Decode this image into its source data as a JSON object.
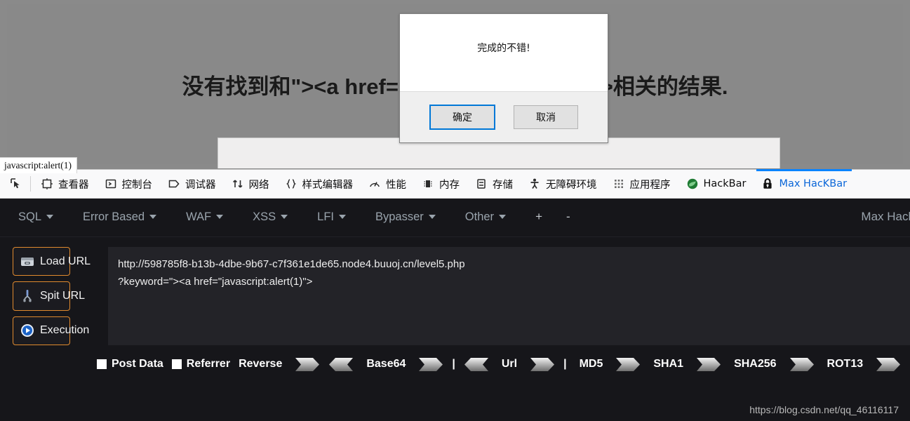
{
  "webpage": {
    "heading": "没有找到和\"><a href=\"javascript:alert(1)\">相关的结果.",
    "heading_left": "没有找到和\"><a href=\"javascript:alert",
    "heading_right": "(1)\">相关的结果."
  },
  "status_tooltip": {
    "text": "javascript:alert(1)"
  },
  "dialog": {
    "message": "完成的不错!",
    "ok_label": "确定",
    "cancel_label": "取消"
  },
  "devtools": {
    "picker_icon": "element-picker-icon",
    "tabs": [
      {
        "label": "查看器",
        "icon": "inspector-icon",
        "active": false
      },
      {
        "label": "控制台",
        "icon": "console-icon",
        "active": false
      },
      {
        "label": "调试器",
        "icon": "debugger-icon",
        "active": false
      },
      {
        "label": "网络",
        "icon": "network-icon",
        "active": false
      },
      {
        "label": "样式编辑器",
        "icon": "style-editor-icon",
        "active": false
      },
      {
        "label": "性能",
        "icon": "performance-icon",
        "active": false
      },
      {
        "label": "内存",
        "icon": "memory-icon",
        "active": false
      },
      {
        "label": "存储",
        "icon": "storage-icon",
        "active": false
      },
      {
        "label": "无障碍环境",
        "icon": "accessibility-icon",
        "active": false
      },
      {
        "label": "应用程序",
        "icon": "application-icon",
        "active": false
      },
      {
        "label": "HackBar",
        "icon": "hackbar-icon",
        "active": false
      },
      {
        "label": "Max HacKBar",
        "icon": "lock-icon",
        "active": true
      }
    ]
  },
  "hackbar": {
    "menu": [
      {
        "label": "SQL",
        "caret": true
      },
      {
        "label": "Error Based",
        "caret": true
      },
      {
        "label": "WAF",
        "caret": true
      },
      {
        "label": "XSS",
        "caret": true
      },
      {
        "label": "LFI",
        "caret": true
      },
      {
        "label": "Bypasser",
        "caret": true
      },
      {
        "label": "Other",
        "caret": true
      }
    ],
    "add_label": "+",
    "remove_label": "-",
    "brand": "Max Hack",
    "buttons": [
      {
        "label": "Load URL",
        "icon": "load-url-icon"
      },
      {
        "label": "Spit URL",
        "icon": "spit-url-icon"
      },
      {
        "label": "Execution",
        "icon": "execution-icon"
      }
    ],
    "url_line1": "http://598785f8-b13b-4dbe-9b67-c7f361e1de65.node4.buuoj.cn/level5.php",
    "url_line2": "?keyword=\"><a href=\"javascript:alert(1)\">",
    "url_value": "http://598785f8-b13b-4dbe-9b67-c7f361e1de65.node4.buuoj.cn/level5.php?keyword=\"><a href=\"javascript:alert(1)\">",
    "post_data_label": "Post Data",
    "referrer_label": "Referrer",
    "encoders": [
      {
        "label": "Reverse",
        "right": true,
        "left": true,
        "sep_after": false
      },
      {
        "label": "Base64",
        "right": true,
        "left": true,
        "sep_after": true
      },
      {
        "label": "Url",
        "right": true,
        "left": false,
        "sep_after": true
      },
      {
        "label": "MD5",
        "right": true,
        "left": false,
        "sep_after": false
      },
      {
        "label": "SHA1",
        "right": true,
        "left": false,
        "sep_after": false
      },
      {
        "label": "SHA256",
        "right": true,
        "left": false,
        "sep_after": false
      },
      {
        "label": "ROT13",
        "right": true,
        "left": false,
        "sep_after": false
      }
    ],
    "separator": "|"
  },
  "watermark": {
    "text": "https://blog.csdn.net/qq_46116117"
  },
  "colors": {
    "accent": "#0a84ff",
    "hackbar_border": "#e08a2e",
    "panel_bg": "#16161a",
    "page_bg": "#8a8a8a"
  }
}
